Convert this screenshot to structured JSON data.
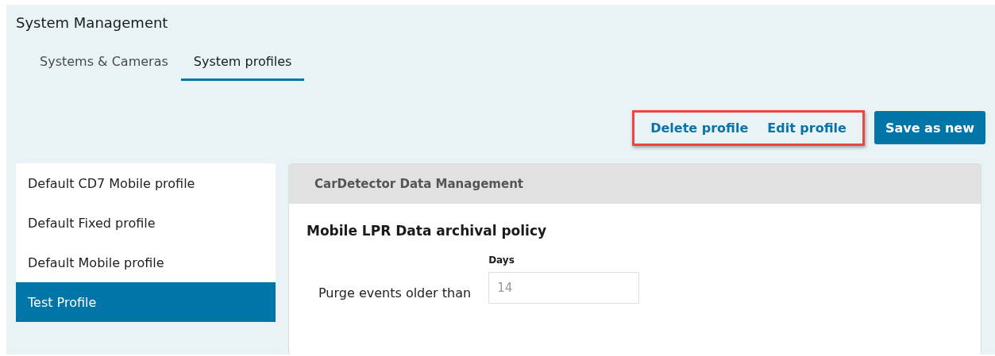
{
  "title": "System Management",
  "tabs": [
    {
      "label": "Systems & Cameras",
      "selected": false
    },
    {
      "label": "System profiles",
      "selected": true
    }
  ],
  "actions": {
    "highlighted": true,
    "links": [
      "Delete profile",
      "Edit profile"
    ]
  },
  "primary_button": "Save as new",
  "profiles": [
    {
      "label": "Default CD7 Mobile profile",
      "selected": false
    },
    {
      "label": "Default Fixed profile",
      "selected": false
    },
    {
      "label": "Default Mobile profile",
      "selected": false
    },
    {
      "label": "Test Profile",
      "selected": true
    }
  ],
  "panel": {
    "header": "CarDetector Data Management",
    "section_title": "Mobile LPR Data archival policy",
    "field_label": "Purge events older than",
    "column_label": "Days",
    "value": "14"
  }
}
